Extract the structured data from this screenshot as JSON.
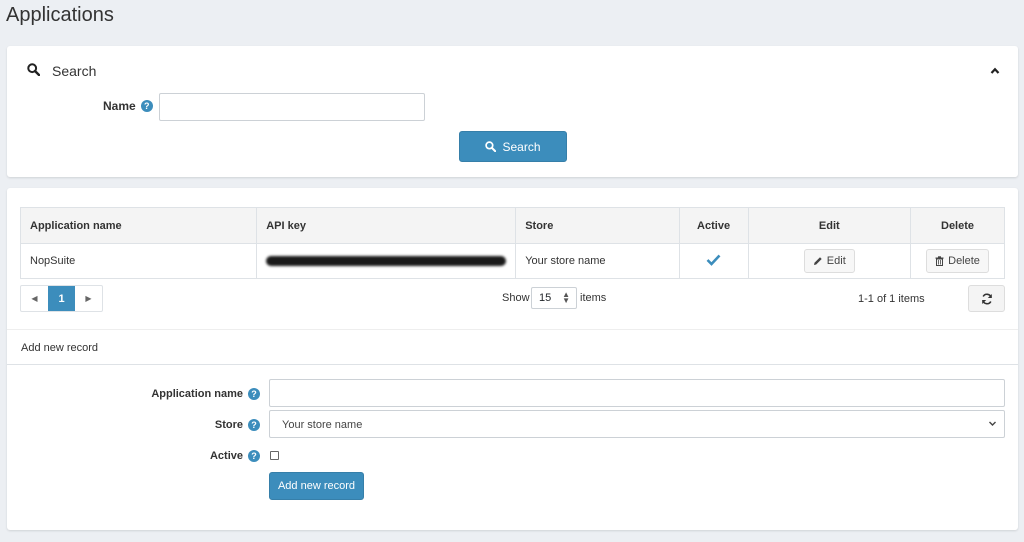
{
  "page": {
    "title": "Applications"
  },
  "search": {
    "heading": "Search",
    "name_label": "Name",
    "name_value": "",
    "button_label": "Search"
  },
  "grid": {
    "columns": [
      "Application name",
      "API key",
      "Store",
      "Active",
      "Edit",
      "Delete"
    ],
    "rows": [
      {
        "app_name": "NopSuite",
        "api_key": "",
        "store": "Your store name",
        "active": true,
        "edit_label": "Edit",
        "delete_label": "Delete"
      }
    ],
    "pager": {
      "current_page": "1",
      "show_label": "Show",
      "page_size": "15",
      "items_label": "items",
      "count_text": "1-1 of 1 items"
    }
  },
  "add_record": {
    "heading": "Add new record",
    "app_name_label": "Application name",
    "app_name_value": "",
    "store_label": "Store",
    "store_selected": "Your store name",
    "active_label": "Active",
    "active_checked": false,
    "button_label": "Add new record"
  },
  "colors": {
    "primary": "#3c8dbc",
    "background": "#eceff3"
  }
}
